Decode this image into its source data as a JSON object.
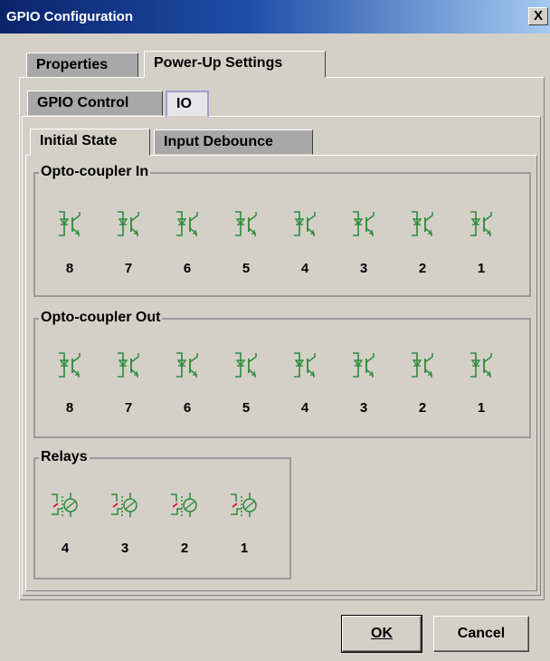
{
  "window": {
    "title": "GPIO Configuration",
    "close_label": "X"
  },
  "main_tabs": [
    {
      "label": "Properties"
    },
    {
      "label": "Power-Up Settings"
    }
  ],
  "sub_tabs": [
    {
      "label": "GPIO Control"
    },
    {
      "label": "IO"
    }
  ],
  "inner_tabs": [
    {
      "label": "Initial State"
    },
    {
      "label": "Input Debounce"
    }
  ],
  "groups": {
    "opto_in": {
      "title": "Opto-coupler In",
      "labels": [
        "8",
        "7",
        "6",
        "5",
        "4",
        "3",
        "2",
        "1"
      ]
    },
    "opto_out": {
      "title": "Opto-coupler Out",
      "labels": [
        "8",
        "7",
        "6",
        "5",
        "4",
        "3",
        "2",
        "1"
      ]
    },
    "relays": {
      "title": "Relays",
      "labels": [
        "4",
        "3",
        "2",
        "1"
      ]
    }
  },
  "buttons": {
    "ok": "OK",
    "cancel": "Cancel"
  },
  "colors": {
    "opto": "#2e8b3c",
    "relay_contact": "#d02020",
    "relay_coil": "#2e8b3c"
  }
}
